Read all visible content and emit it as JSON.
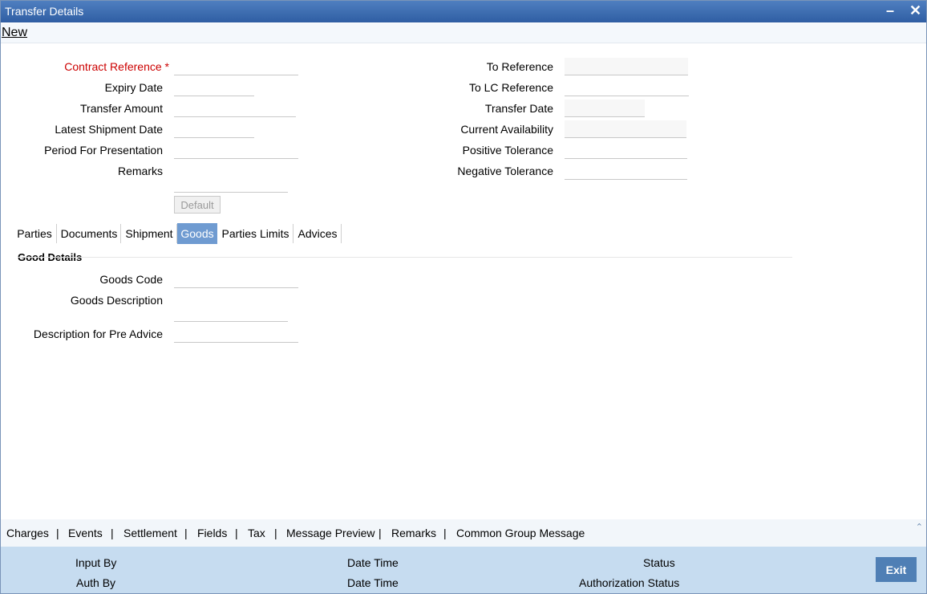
{
  "window": {
    "title": "Transfer Details"
  },
  "menubar": {
    "new_label": "New"
  },
  "form_left": {
    "contract_reference": {
      "label": "Contract Reference",
      "required": "*",
      "value": ""
    },
    "expiry_date": {
      "label": "Expiry Date",
      "value": ""
    },
    "transfer_amount": {
      "label": "Transfer Amount",
      "value": ""
    },
    "latest_shipment_date": {
      "label": "Latest Shipment Date",
      "value": ""
    },
    "period_for_presentation": {
      "label": "Period For Presentation",
      "value": ""
    },
    "remarks": {
      "label": "Remarks",
      "value": ""
    }
  },
  "form_right": {
    "to_reference": {
      "label": "To Reference",
      "value": ""
    },
    "to_lc_reference": {
      "label": "To LC Reference",
      "value": ""
    },
    "transfer_date": {
      "label": "Transfer Date",
      "value": ""
    },
    "current_availability": {
      "label": "Current Availability",
      "value": ""
    },
    "positive_tolerance": {
      "label": "Positive Tolerance",
      "value": ""
    },
    "negative_tolerance": {
      "label": "Negative Tolerance",
      "value": ""
    }
  },
  "default_button": "Default",
  "tabs": [
    "Parties",
    "Documents",
    "Shipment",
    "Goods",
    "Parties Limits",
    "Advices"
  ],
  "active_tab": "Goods",
  "goods": {
    "section_title": "Good Details",
    "goods_code": {
      "label": "Goods Code",
      "value": ""
    },
    "goods_description": {
      "label": "Goods Description",
      "value": ""
    },
    "pre_advice_description": {
      "label": "Description for Pre Advice",
      "value": ""
    }
  },
  "bottom_links": [
    "Charges",
    "Events",
    "Settlement",
    "Fields",
    "Tax",
    "Message Preview",
    "Remarks",
    "Common Group Message"
  ],
  "footer": {
    "input_by": "Input By",
    "date_time_1": "Date Time",
    "status": "Status",
    "auth_by": "Auth By",
    "date_time_2": "Date Time",
    "authorization_status": "Authorization Status",
    "exit_label": "Exit"
  },
  "colors": {
    "titlebar": "#3a69ad",
    "active_tab": "#6f9bd1",
    "footer": "#c6dcf0",
    "required": "#cc0000",
    "exit_button": "#4f7fb5"
  }
}
